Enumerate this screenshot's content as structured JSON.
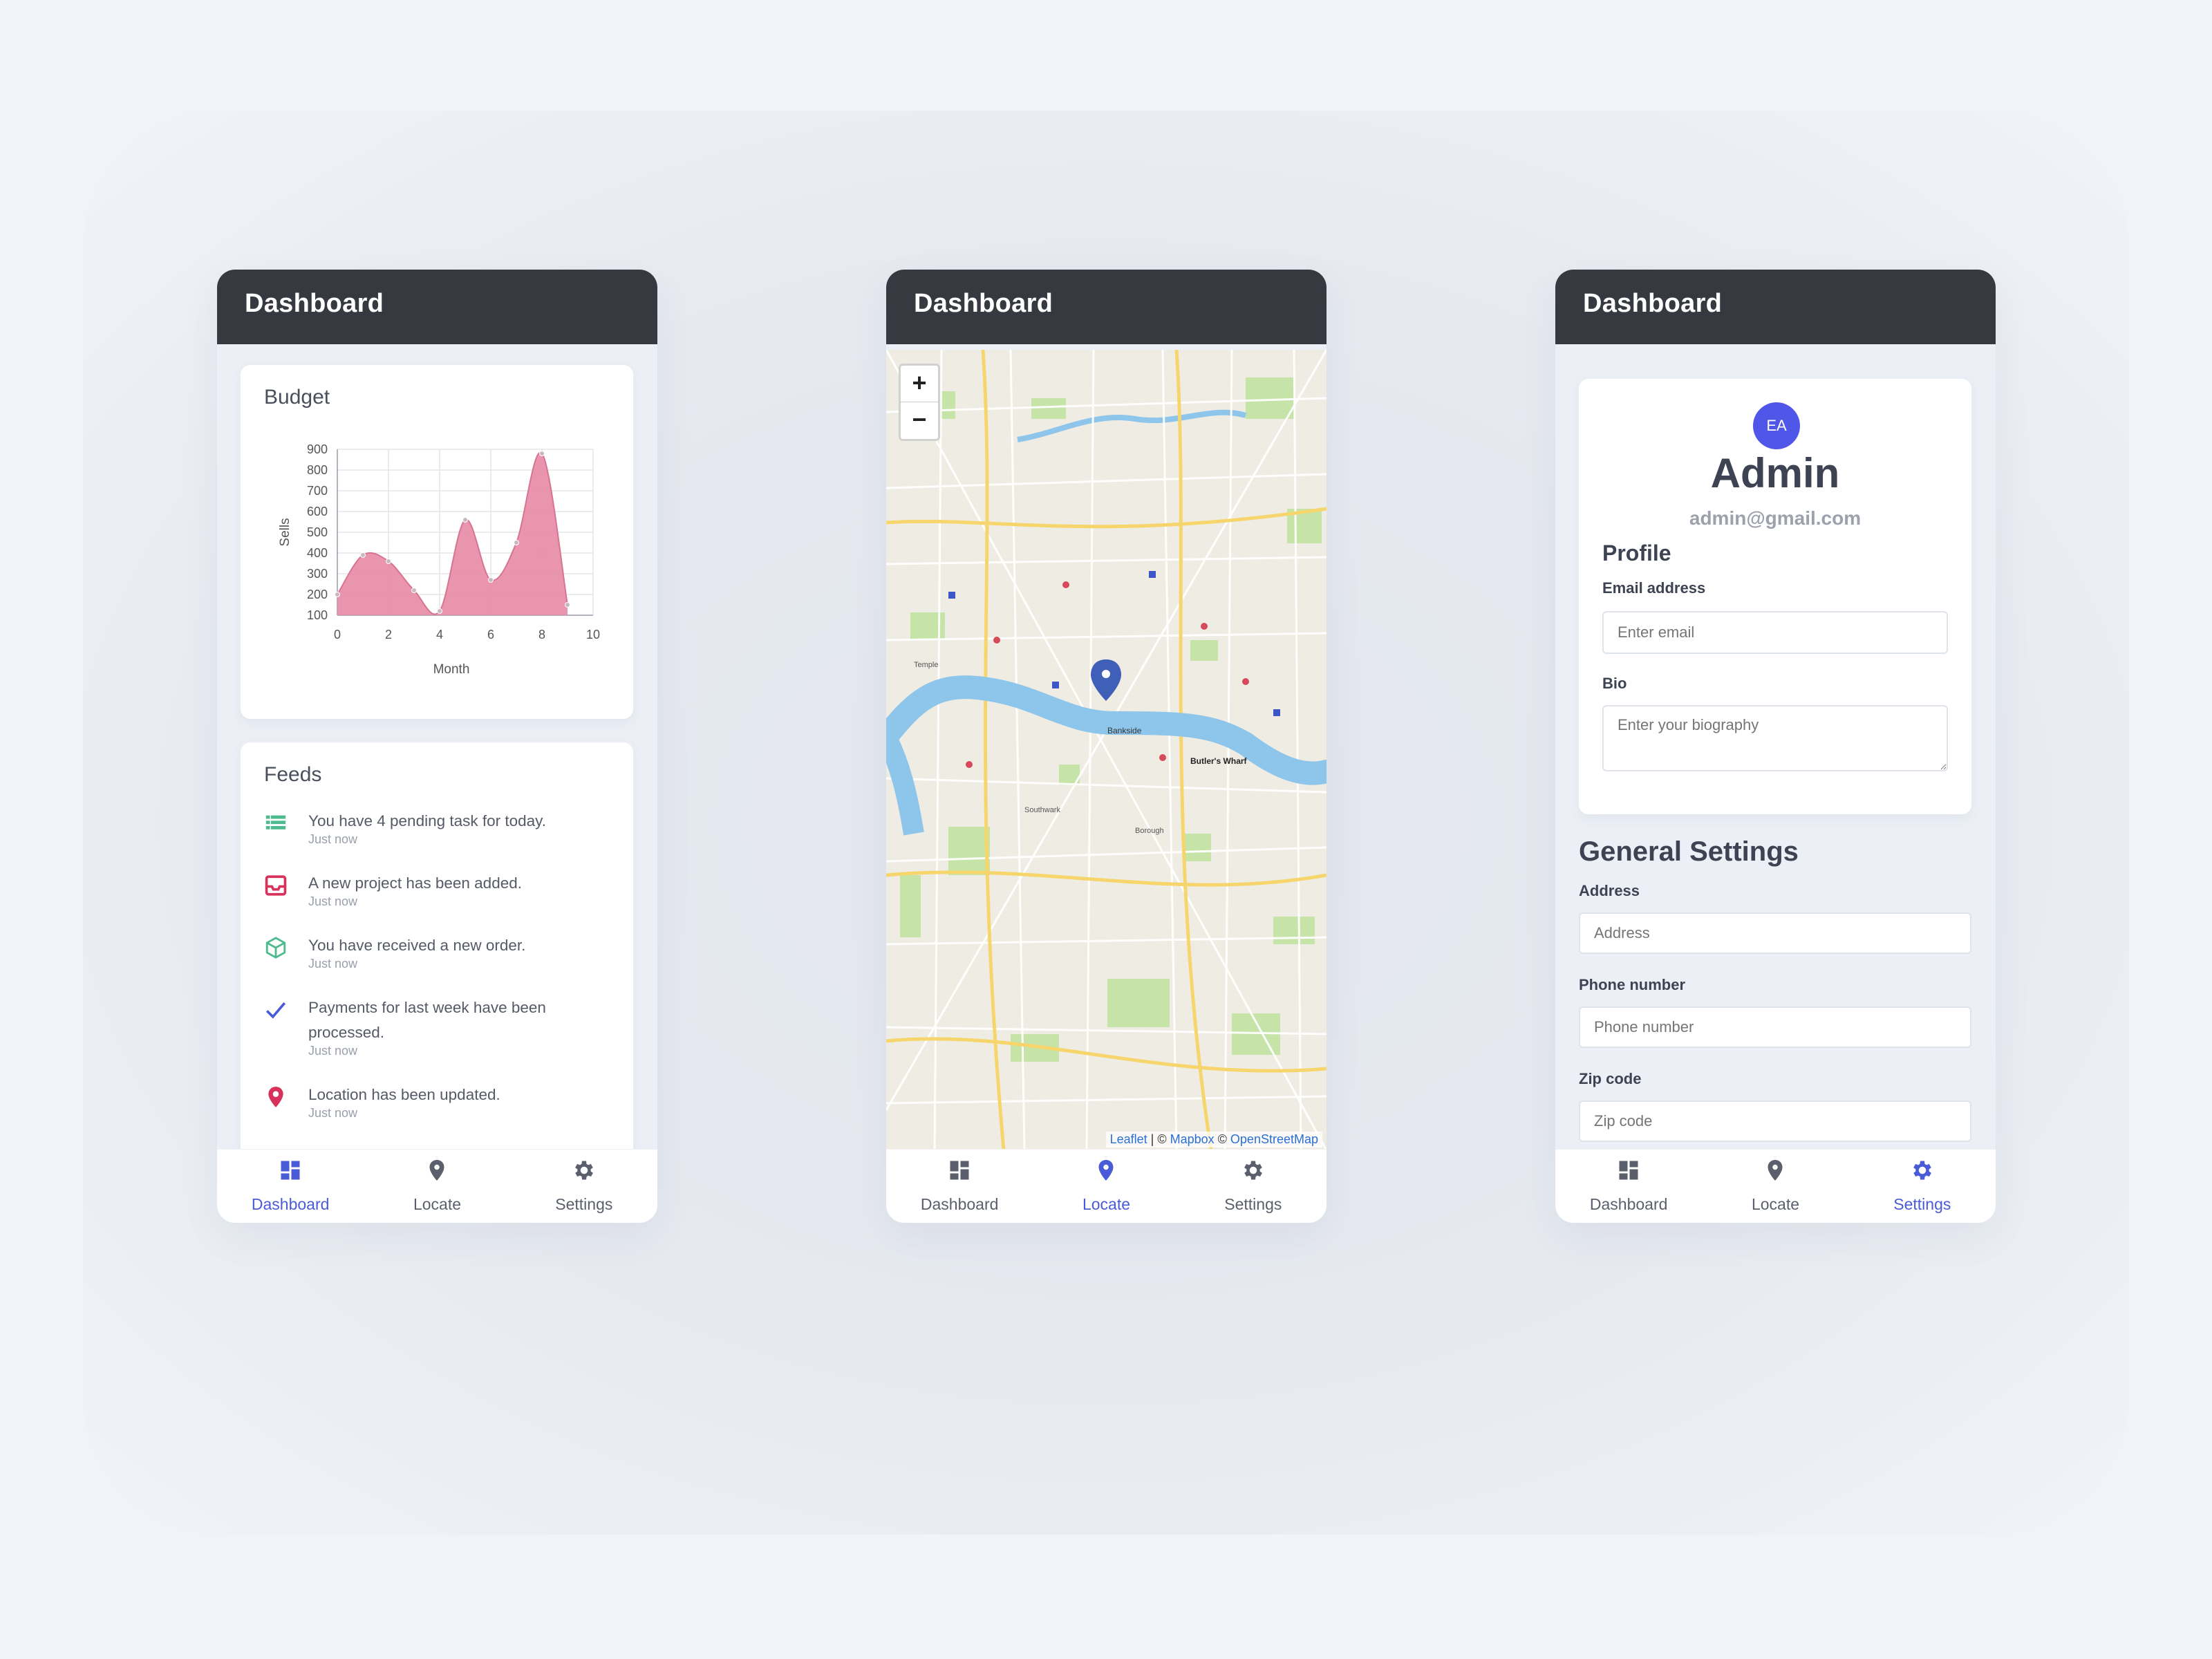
{
  "app": {
    "title": "Dashboard"
  },
  "nav": [
    {
      "label": "Dashboard",
      "icon": "dashboard-icon"
    },
    {
      "label": "Locate",
      "icon": "location-pin-icon"
    },
    {
      "label": "Settings",
      "icon": "gear-icon"
    }
  ],
  "colors": {
    "topbar": "#363940",
    "accent": "#4a5bd8",
    "chart_fill": "#e889a6",
    "avatar": "#4f56e8"
  },
  "screen1": {
    "budget": {
      "title": "Budget"
    },
    "feeds": {
      "title": "Feeds",
      "items": [
        {
          "icon": "list-icon",
          "text": "You have 4 pending task for today.",
          "time": "Just now"
        },
        {
          "icon": "inbox-icon",
          "text": "A new project has been added.",
          "time": "Just now"
        },
        {
          "icon": "box-icon",
          "text": "You have received a new order.",
          "time": "Just now"
        },
        {
          "icon": "check-icon",
          "text": "Payments for last week have been processed.",
          "time": "Just now"
        },
        {
          "icon": "location-pin-icon",
          "text": "Location has been updated.",
          "time": "Just now"
        }
      ]
    }
  },
  "chart_data": {
    "type": "area",
    "title": "Budget",
    "xlabel": "Month",
    "ylabel": "Sells",
    "xlim": [
      0,
      10
    ],
    "ylim": [
      100,
      900
    ],
    "x_ticks": [
      0,
      2,
      4,
      6,
      8,
      10
    ],
    "y_ticks": [
      100,
      200,
      300,
      400,
      500,
      600,
      700,
      800,
      900
    ],
    "grid": true,
    "series": [
      {
        "x": [
          0,
          1,
          2,
          3,
          4,
          5,
          6,
          7,
          8,
          9
        ],
        "values": [
          200,
          390,
          360,
          220,
          120,
          560,
          270,
          450,
          880,
          150
        ]
      }
    ]
  },
  "screen2": {
    "map": {
      "zoom_in": "+",
      "zoom_out": "−",
      "attribution": {
        "leaflet": "Leaflet",
        "sep": " | © ",
        "mapbox": "Mapbox",
        "sep2": " © ",
        "osm": "OpenStreetMap"
      },
      "labels": [
        "Bankside",
        "Borough",
        "Butler's Wharf",
        "Temple",
        "Southwark"
      ]
    }
  },
  "screen3": {
    "avatar_initials": "EA",
    "name": "Admin",
    "email": "admin@gmail.com",
    "profile": {
      "heading": "Profile",
      "email_label": "Email address",
      "email_placeholder": "Enter email",
      "bio_label": "Bio",
      "bio_placeholder": "Enter your biography"
    },
    "general": {
      "heading": "General Settings",
      "address_label": "Address",
      "address_placeholder": "Address",
      "phone_label": "Phone number",
      "phone_placeholder": "Phone number",
      "zip_label": "Zip code",
      "zip_placeholder": "Zip code"
    }
  }
}
